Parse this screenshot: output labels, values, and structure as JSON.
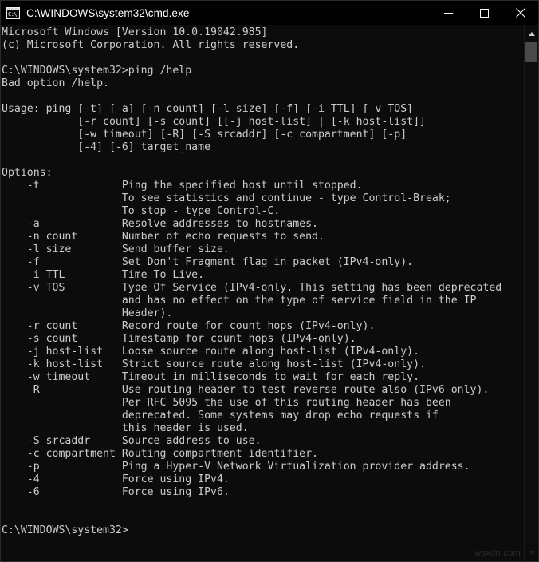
{
  "window": {
    "title": "C:\\WINDOWS\\system32\\cmd.exe",
    "icon": "cmd-console-icon",
    "icon_glyph": "C:\\",
    "background_color": "#0c0c0c",
    "text_color": "#cccccc",
    "titlebar_color": "#000000",
    "controls": {
      "minimize_label": "Minimize",
      "maximize_label": "Maximize",
      "close_label": "Close"
    }
  },
  "scrollbar": {
    "up_arrow_label": "Scroll up",
    "down_arrow_label": "Scroll down",
    "thumb_position_percent": 0,
    "thumb_size_percent": 4
  },
  "watermark": {
    "text": "wsxdn.com"
  },
  "terminal": {
    "banner": [
      "Microsoft Windows [Version 10.0.19042.985]",
      "(c) Microsoft Corporation. All rights reserved."
    ],
    "prompt_path": "C:\\WINDOWS\\system32>",
    "command": "ping /help",
    "error": "Bad option /help.",
    "usage_lines": [
      "Usage: ping [-t] [-a] [-n count] [-l size] [-f] [-i TTL] [-v TOS]",
      "            [-r count] [-s count] [[-j host-list] | [-k host-list]]",
      "            [-w timeout] [-R] [-S srcaddr] [-c compartment] [-p]",
      "            [-4] [-6] target_name"
    ],
    "options_header": "Options:",
    "options": [
      {
        "flag": "-t",
        "desc": [
          "Ping the specified host until stopped.",
          "To see statistics and continue - type Control-Break;",
          "To stop - type Control-C."
        ]
      },
      {
        "flag": "-a",
        "desc": [
          "Resolve addresses to hostnames."
        ]
      },
      {
        "flag": "-n count",
        "desc": [
          "Number of echo requests to send."
        ]
      },
      {
        "flag": "-l size",
        "desc": [
          "Send buffer size."
        ]
      },
      {
        "flag": "-f",
        "desc": [
          "Set Don't Fragment flag in packet (IPv4-only)."
        ]
      },
      {
        "flag": "-i TTL",
        "desc": [
          "Time To Live."
        ]
      },
      {
        "flag": "-v TOS",
        "desc": [
          "Type Of Service (IPv4-only. This setting has been deprecated",
          "and has no effect on the type of service field in the IP",
          "Header)."
        ]
      },
      {
        "flag": "-r count",
        "desc": [
          "Record route for count hops (IPv4-only)."
        ]
      },
      {
        "flag": "-s count",
        "desc": [
          "Timestamp for count hops (IPv4-only)."
        ]
      },
      {
        "flag": "-j host-list",
        "desc": [
          "Loose source route along host-list (IPv4-only)."
        ]
      },
      {
        "flag": "-k host-list",
        "desc": [
          "Strict source route along host-list (IPv4-only)."
        ]
      },
      {
        "flag": "-w timeout",
        "desc": [
          "Timeout in milliseconds to wait for each reply."
        ]
      },
      {
        "flag": "-R",
        "desc": [
          "Use routing header to test reverse route also (IPv6-only).",
          "Per RFC 5095 the use of this routing header has been",
          "deprecated. Some systems may drop echo requests if",
          "this header is used."
        ]
      },
      {
        "flag": "-S srcaddr",
        "desc": [
          "Source address to use."
        ]
      },
      {
        "flag": "-c compartment",
        "desc": [
          "Routing compartment identifier."
        ]
      },
      {
        "flag": "-p",
        "desc": [
          "Ping a Hyper-V Network Virtualization provider address."
        ]
      },
      {
        "flag": "-4",
        "desc": [
          "Force using IPv4."
        ]
      },
      {
        "flag": "-6",
        "desc": [
          "Force using IPv6."
        ]
      }
    ],
    "final_prompt": "C:\\WINDOWS\\system32>"
  }
}
